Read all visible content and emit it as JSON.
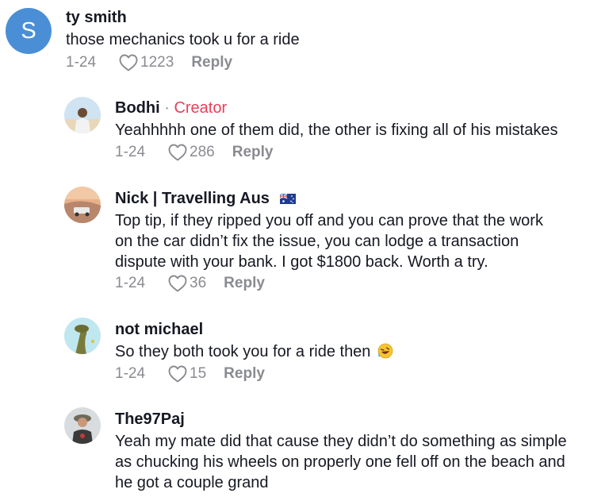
{
  "comments": [
    {
      "avatar_letter": "S",
      "username": "ty smith",
      "lines": [
        "those mechanics took u for a ride"
      ],
      "date": "1-24",
      "likes": "1223",
      "reply_label": "Reply"
    },
    {
      "username": "Bodhi",
      "creator_sep": "·",
      "creator_label": "Creator",
      "lines": [
        "Yeahhhhh one of them did, the other is fixing all of his mistakes"
      ],
      "date": "1-24",
      "likes": "286",
      "reply_label": "Reply"
    },
    {
      "username": "Nick | Travelling Aus",
      "lines": [
        "Top tip, if they ripped you off and you can prove that the work",
        "on the car didn’t fix the issue, you can lodge a transaction",
        "dispute with your bank. I got $1800 back. Worth a try."
      ],
      "date": "1-24",
      "likes": "36",
      "reply_label": "Reply"
    },
    {
      "username": "not michael",
      "lines": [
        "So they both took you for a ride then"
      ],
      "date": "1-24",
      "likes": "15",
      "reply_label": "Reply"
    },
    {
      "username": "The97Paj",
      "lines": [
        "Yeah my mate did that cause they didn’t do something as simple",
        "as chucking his wheels on properly one fell off on the beach and",
        "he got a couple grand"
      ]
    }
  ],
  "colors": {
    "creator": "#e8405a",
    "meta": "#8a8b91",
    "avatar_top": "#4a8fd6"
  },
  "icons": {
    "like": "heart-outline-icon",
    "flag": "australia-flag-icon",
    "emoji": "rofl-emoji-icon"
  }
}
